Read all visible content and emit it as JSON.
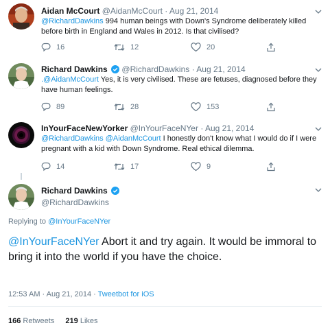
{
  "replies": [
    {
      "name": "Aidan McCourt",
      "handle": "@AidanMcCourt",
      "sep": "·",
      "date": "Aug 21, 2014",
      "mention": "@RichardDawkins",
      "text": " 994 human beings with Down's Syndrome deliberately killed before birth in England and Wales in 2012. Is that civilised?",
      "reply_count": "16",
      "retweet_count": "12",
      "like_count": "20"
    },
    {
      "name": "Richard Dawkins",
      "handle": "@RichardDawkins",
      "sep": "·",
      "date": "Aug 21, 2014",
      "mention": ".@AidanMcCourt",
      "text": " Yes, it is very civilised. These are fetuses, diagnosed before they have human feelings.",
      "reply_count": "89",
      "retweet_count": "28",
      "like_count": "153"
    },
    {
      "name": "InYourFaceNewYorker",
      "handle": "@InYourFaceNYer",
      "sep": "·",
      "date": "Aug 21, 2014",
      "mention": "@RichardDawkins @AidanMcCourt",
      "text": " I honestly don't know what I would do if I were pregnant with a kid with Down Syndrome. Real ethical dilemma.",
      "reply_count": "14",
      "retweet_count": "17",
      "like_count": "9"
    }
  ],
  "main_tweet": {
    "name": "Richard Dawkins",
    "handle": "@RichardDawkins",
    "replying_prefix": "Replying to ",
    "replying_to": "@InYourFaceNYer",
    "mention": "@InYourFaceNYer",
    "text": " Abort it and try again. It would be immoral to bring it into the world if you have the choice.",
    "time_date": "12:53 AM · Aug 21, 2014",
    "sep": " · ",
    "source": "Tweetbot for iOS",
    "retweets_count": "166",
    "retweets_label": " Retweets",
    "likes_count": "219",
    "likes_label": " Likes"
  },
  "colors": {
    "link": "#1b95e0",
    "muted": "#657786",
    "verified": "#1da1f2"
  },
  "icons": [
    "reply-icon",
    "retweet-icon",
    "like-icon",
    "share-icon",
    "chevron-down-icon",
    "verified-badge-icon"
  ]
}
